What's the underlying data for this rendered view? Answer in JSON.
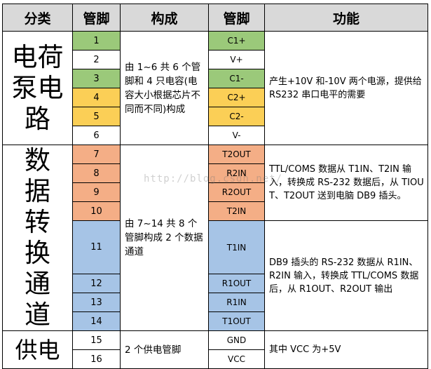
{
  "headers": {
    "category": "分类",
    "pin": "管脚",
    "composition": "构成",
    "pin_name": "管脚",
    "function": "功能"
  },
  "sections": [
    {
      "category": "电荷泵电路",
      "composition": "由 1~6 共 6 个管脚和 4 只电容(电容大小根据芯片不同而不同)构成",
      "function": "产生+10V 和-10V 两个电源，提供给 RS232 串口电平的需要",
      "rows": [
        {
          "pin": "1",
          "name": "C1+",
          "color": "green"
        },
        {
          "pin": "2",
          "name": "V+",
          "color": "white"
        },
        {
          "pin": "3",
          "name": "C1-",
          "color": "green"
        },
        {
          "pin": "4",
          "name": "C2+",
          "color": "yellow"
        },
        {
          "pin": "5",
          "name": "C2-",
          "color": "yellow"
        },
        {
          "pin": "6",
          "name": "V-",
          "color": "white"
        }
      ]
    },
    {
      "category": "数据转换通道",
      "composition": "由 7~14 共 8 个管脚构成 2 个数据通道",
      "function_a": "TTL/COMS 数据从 T1IN、T2IN 输入，转换成 RS-232 数据后，从 TIOUT、T2OUT 送到电脑 DB9 插头。",
      "function_b": "DB9 插头的 RS-232 数据从 R1IN、R2IN 输入，转换成 TTL/COMS 数据后，从 R1OUT、R2OUT 输出",
      "rows": [
        {
          "pin": "7",
          "name": "T2OUT",
          "color": "salmon"
        },
        {
          "pin": "8",
          "name": "R2IN",
          "color": "salmon"
        },
        {
          "pin": "9",
          "name": "R2OUT",
          "color": "salmon"
        },
        {
          "pin": "10",
          "name": "T2IN",
          "color": "salmon"
        },
        {
          "pin": "11",
          "name": "T1IN",
          "color": "blue"
        },
        {
          "pin": "12",
          "name": "R1OUT",
          "color": "blue"
        },
        {
          "pin": "13",
          "name": "R1IN",
          "color": "blue"
        },
        {
          "pin": "14",
          "name": "T1OUT",
          "color": "blue"
        }
      ]
    },
    {
      "category": "供电",
      "composition": "2 个供电管脚",
      "function": "其中 VCC 为+5V",
      "rows": [
        {
          "pin": "15",
          "name": "GND",
          "color": "white"
        },
        {
          "pin": "16",
          "name": "VCC",
          "color": "white"
        }
      ]
    }
  ],
  "watermark": "http://blog.csdn.net/",
  "colors": {
    "header_bg": "#d9d9d9",
    "green": "#9bc97a",
    "yellow": "#fbcf56",
    "salmon": "#f4ae86",
    "blue": "#a6c4e6"
  }
}
